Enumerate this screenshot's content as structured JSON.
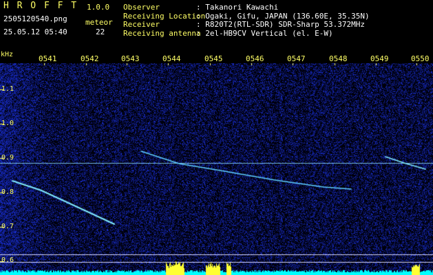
{
  "app": {
    "name": "H R O F F T",
    "version": "1.0.0"
  },
  "file": {
    "name": "2505120540.png",
    "datetime": "25.05.12 05:40"
  },
  "meteor": {
    "label": "meteor",
    "count": "22"
  },
  "info": [
    {
      "label": "Observer",
      "value": ": Takanori Kawachi"
    },
    {
      "label": "Receiving Location",
      "value": ": Ogaki, Gifu, JAPAN (136.60E, 35.35N)"
    },
    {
      "label": "Receiver",
      "value": ": R820T2(RTL-SDR) SDR-Sharp 53.372MHz"
    },
    {
      "label": "Receiving antenna",
      "value": ": 2el-HB9CV Vertical (el. E-W)"
    }
  ],
  "axis": {
    "unit": "kHz",
    "y_ticks": [
      "1.1",
      "1.0",
      "0.9",
      "0.8",
      "0.7",
      "0.6"
    ],
    "y_values": [
      1.1,
      1.0,
      0.9,
      0.8,
      0.7,
      0.6
    ],
    "x_ticks": [
      "0541",
      "0542",
      "0543",
      "0544",
      "0545",
      "0546",
      "0547",
      "0548",
      "0549",
      "0550"
    ]
  },
  "colors": {
    "header_yellow": "#ffff66",
    "background": "#000000",
    "noise": "#1a2aa8",
    "trail": "#7fe9ff",
    "level": "#00ffff"
  }
}
